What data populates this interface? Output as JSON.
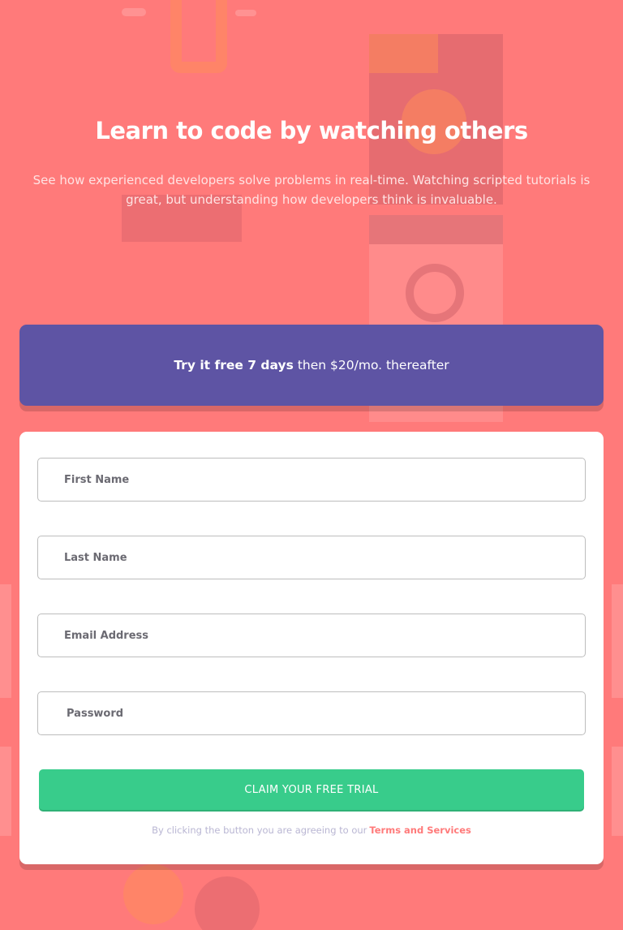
{
  "hero": {
    "title": "Learn to code by watching others",
    "description": "See how experienced developers solve problems in real-time. Watching scripted tutorials is great, but understanding how developers think is invaluable."
  },
  "promo": {
    "highlight": "Try it free 7 days",
    "rest": "then $20/mo. thereafter"
  },
  "form": {
    "first_name_placeholder": "First Name",
    "last_name_placeholder": "Last Name",
    "email_placeholder": "Email Address",
    "password_placeholder": "Password",
    "submit_label": "CLAIM YOUR FREE TRIAL",
    "terms_text": "By clicking the button you are agreeing to our",
    "terms_link": "Terms and Services"
  },
  "colors": {
    "background": "#ff7a7a",
    "promo": "#5e54a4",
    "submit": "#38cc8b",
    "terms_link": "#ff7a7a"
  }
}
